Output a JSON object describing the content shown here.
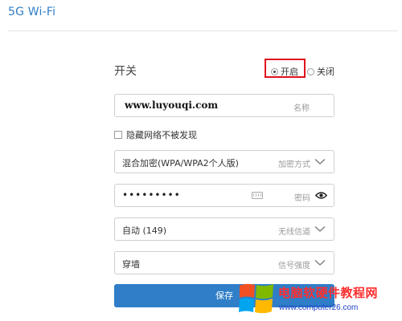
{
  "header": {
    "title": "5G Wi-Fi"
  },
  "switch": {
    "label": "开关",
    "on_label": "开启",
    "off_label": "关闭",
    "selected": "开启",
    "highlight_color": "#e0101c"
  },
  "ssid": {
    "value": "www.luyouqi.com",
    "hint": "名称"
  },
  "hide_network": {
    "label": "隐藏网络不被发现",
    "checked": false
  },
  "encryption": {
    "value": "混合加密(WPA/WPA2个人版)",
    "hint": "加密方式",
    "icon": "chevron-down-icon"
  },
  "password": {
    "value": "•••••••••",
    "hint": "密码",
    "keyboard_icon": "keyboard-icon",
    "eye_icon": "eye-icon"
  },
  "channel": {
    "value": "自动 (149)",
    "hint": "无线信道",
    "icon": "chevron-down-icon"
  },
  "signal": {
    "value": "穿墙",
    "hint": "信号强度",
    "icon": "chevron-down-icon"
  },
  "save": {
    "label": "保存",
    "color": "#2f7ec7"
  },
  "watermark": {
    "title": "电脑软硬件教程网",
    "url": "www.computer26.com"
  },
  "colors": {
    "accent": "#2f7ec7",
    "border": "#cfcfcf",
    "hint": "#9a9a9a"
  }
}
